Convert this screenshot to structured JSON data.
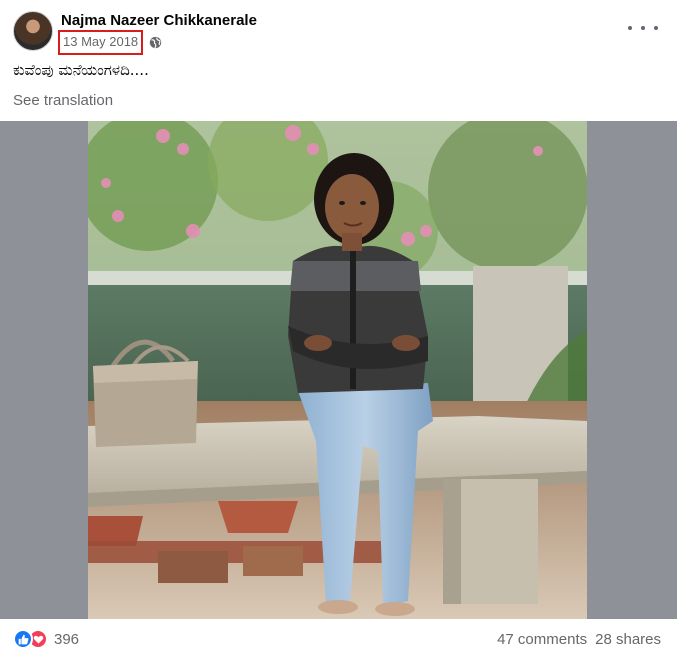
{
  "post": {
    "author": "Najma Nazeer Chikkanerale",
    "date": "13 May 2018",
    "caption": "ಕುವೆಂಪು ಮನೆಯಂಗಳದಿ....",
    "see_translation": "See translation"
  },
  "icons": {
    "privacy": "globe-icon",
    "options": "more-horizontal-icon",
    "reaction_1": "like-icon",
    "reaction_2": "love-icon"
  },
  "colors": {
    "date_highlight_border": "#d91c1c",
    "like": "#1877f2",
    "love": "#f33e58",
    "secondary_text": "#65676b",
    "media_background": "#8e9298"
  },
  "footer": {
    "reaction_count": "396",
    "comments": "47 comments",
    "shares": "28 shares"
  }
}
